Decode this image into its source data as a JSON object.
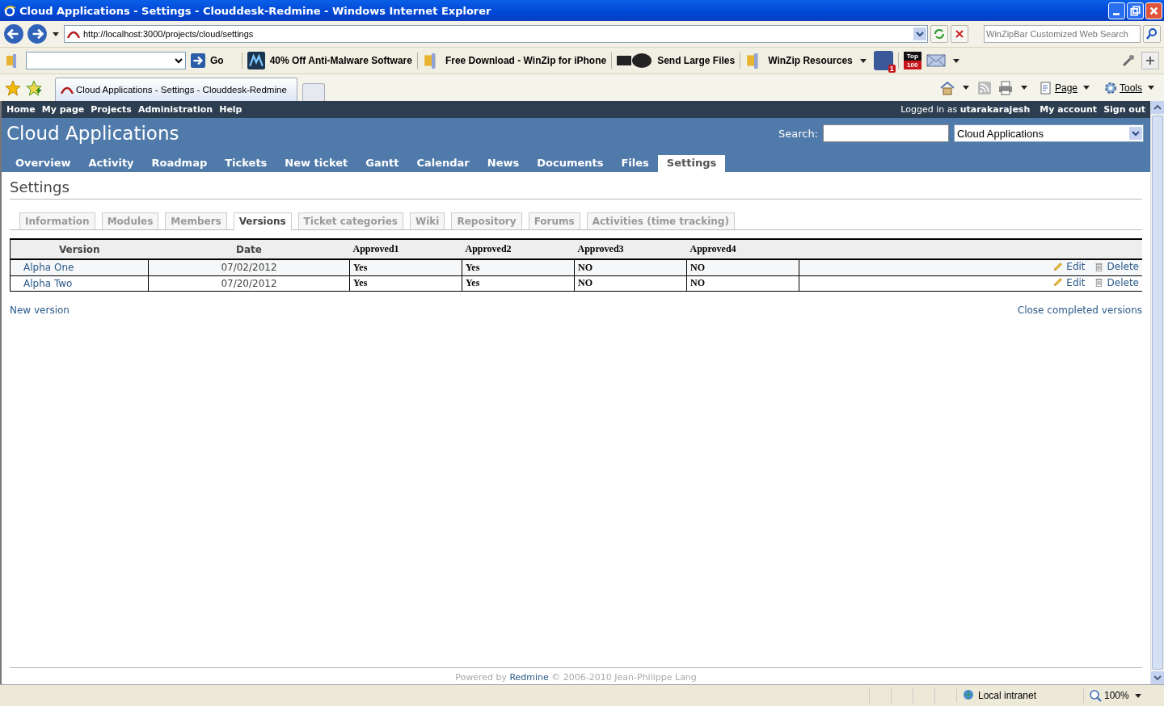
{
  "window": {
    "title": "Cloud Applications - Settings - Clouddesk-Redmine - Windows Internet Explorer"
  },
  "address_bar": {
    "url": "http://localhost:3000/projects/cloud/settings"
  },
  "web_search": {
    "placeholder": "WinZipBar Customized Web Search"
  },
  "toolbar": {
    "go_label": "Go",
    "links": [
      {
        "kind": "malware",
        "label": "40% Off Anti-Malware Software"
      },
      {
        "kind": "winzip",
        "label": "Free Download - WinZip for iPhone"
      },
      {
        "kind": "zipsend",
        "label": "Send Large Files"
      },
      {
        "kind": "winzip",
        "label": "WinZip Resources"
      }
    ],
    "facebook_badge": "1",
    "top_label": "Top",
    "top_count": "100"
  },
  "browser_tab": {
    "title": "Cloud Applications - Settings - Clouddesk-Redmine"
  },
  "command_bar": [
    "Page",
    "Tools"
  ],
  "top_menu": [
    "Home",
    "My page",
    "Projects",
    "Administration",
    "Help"
  ],
  "account": {
    "prefix": "Logged in as",
    "user": "utarakarajesh",
    "links": [
      "My account",
      "Sign out"
    ]
  },
  "project_title": "Cloud Applications",
  "search": {
    "label": "Search:",
    "project": "Cloud Applications"
  },
  "main_tabs": [
    {
      "label": "Overview",
      "selected": false
    },
    {
      "label": "Activity",
      "selected": false
    },
    {
      "label": "Roadmap",
      "selected": false
    },
    {
      "label": "Tickets",
      "selected": false
    },
    {
      "label": "New ticket",
      "selected": false
    },
    {
      "label": "Gantt",
      "selected": false
    },
    {
      "label": "Calendar",
      "selected": false
    },
    {
      "label": "News",
      "selected": false
    },
    {
      "label": "Documents",
      "selected": false
    },
    {
      "label": "Files",
      "selected": false
    },
    {
      "label": "Settings",
      "selected": true
    }
  ],
  "page_title": "Settings",
  "settings_tabs": [
    {
      "label": "Information",
      "selected": false
    },
    {
      "label": "Modules",
      "selected": false
    },
    {
      "label": "Members",
      "selected": false
    },
    {
      "label": "Versions",
      "selected": true
    },
    {
      "label": "Ticket categories",
      "selected": false
    },
    {
      "label": "Wiki",
      "selected": false
    },
    {
      "label": "Repository",
      "selected": false
    },
    {
      "label": "Forums",
      "selected": false
    },
    {
      "label": "Activities (time tracking)",
      "selected": false
    }
  ],
  "versions_table": {
    "columns": [
      "Version",
      "Date",
      "Approved1",
      "Approved2",
      "Approved3",
      "Approved4"
    ],
    "rows": [
      {
        "version": "Alpha One",
        "date": "07/02/2012",
        "approvals": [
          "Yes",
          "Yes",
          "NO",
          "NO"
        ],
        "actions": [
          "Edit",
          "Delete"
        ]
      },
      {
        "version": "Alpha Two",
        "date": "07/20/2012",
        "approvals": [
          "Yes",
          "Yes",
          "NO",
          "NO"
        ],
        "actions": [
          "Edit",
          "Delete"
        ]
      }
    ]
  },
  "new_version": "New version",
  "close_completed": "Close completed versions",
  "footer": {
    "prefix": "Powered by",
    "link": "Redmine",
    "suffix": "© 2006-2010 Jean-Philippe Lang"
  },
  "status_bar": {
    "zone": "Local intranet",
    "zoom": "100%"
  }
}
